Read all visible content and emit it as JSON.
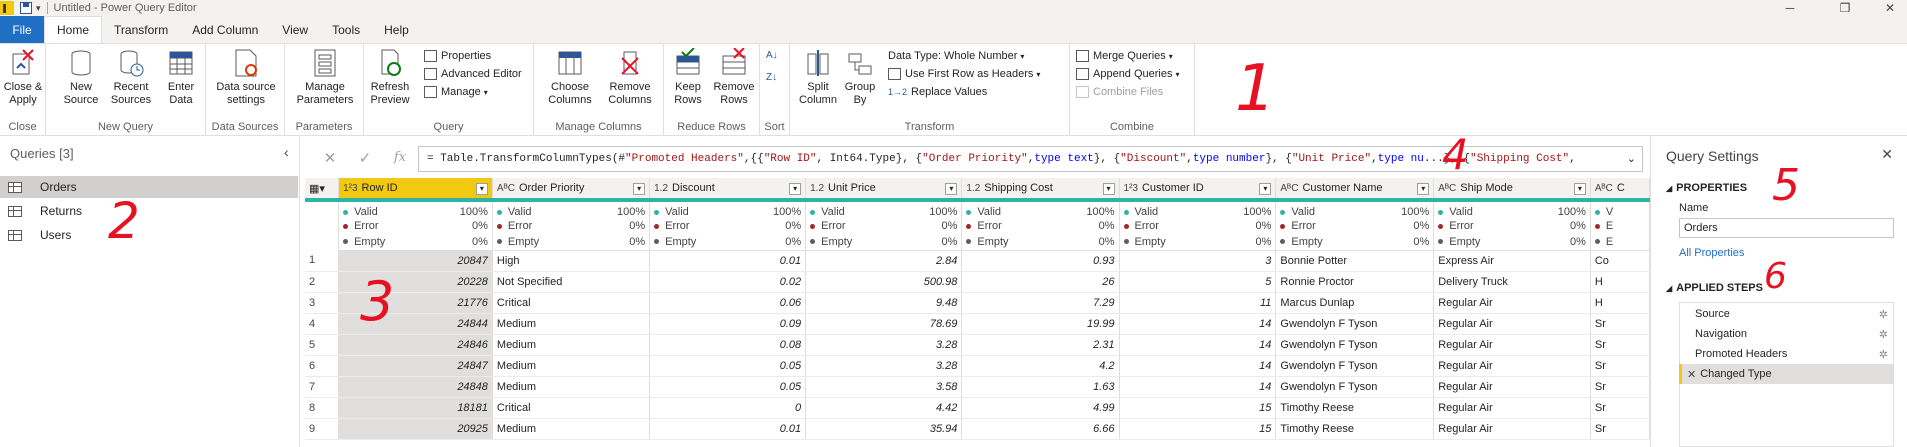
{
  "title": "Untitled - Power Query Editor",
  "tabs": [
    "File",
    "Home",
    "Transform",
    "Add Column",
    "View",
    "Tools",
    "Help"
  ],
  "ribbon": {
    "close_apply": "Close &\nApply",
    "close_group": "Close",
    "new_source": "New\nSource",
    "recent_sources": "Recent\nSources",
    "enter_data": "Enter\nData",
    "new_query_group": "New Query",
    "data_source_settings": "Data source\nsettings",
    "data_sources_group": "Data Sources",
    "manage_parameters": "Manage\nParameters",
    "parameters_group": "Parameters",
    "refresh_preview": "Refresh\nPreview",
    "properties": "Properties",
    "advanced_editor": "Advanced Editor",
    "manage": "Manage",
    "query_group": "Query",
    "choose_columns": "Choose\nColumns",
    "remove_columns": "Remove\nColumns",
    "manage_columns_group": "Manage Columns",
    "keep_rows": "Keep\nRows",
    "remove_rows": "Remove\nRows",
    "reduce_rows_group": "Reduce Rows",
    "sort_group": "Sort",
    "split_column": "Split\nColumn",
    "group_by": "Group\nBy",
    "data_type": "Data Type: Whole Number",
    "use_first_row": "Use First Row as Headers",
    "replace_values": "Replace Values",
    "transform_group": "Transform",
    "merge_queries": "Merge Queries",
    "append_queries": "Append Queries",
    "combine_files": "Combine Files",
    "combine_group": "Combine"
  },
  "formula": {
    "prefix": "= Table.TransformColumnTypes(#",
    "s1": "\"Promoted Headers\"",
    "p2": ",{{",
    "s2": "\"Row ID\"",
    "p3": ", Int64.Type}, {",
    "s3": "\"Order Priority\"",
    "p4": ", ",
    "k4": "type text",
    "p5": "}, {",
    "s5": "\"Discount\"",
    "p6": ", ",
    "k6": "type number",
    "p7": "}, {",
    "s7": "\"Unit Price\"",
    "p8": ", ",
    "k8": "type nu",
    "p9": "...}, {",
    "s9": "\"Shipping Cost\"",
    "p10": ","
  },
  "queries": {
    "header": "Queries [3]",
    "items": [
      "Orders",
      "Returns",
      "Users"
    ]
  },
  "columns": [
    {
      "type": "1²3",
      "name": "Row ID"
    },
    {
      "type": "AᴮC",
      "name": "Order Priority"
    },
    {
      "type": "1.2",
      "name": "Discount"
    },
    {
      "type": "1.2",
      "name": "Unit Price"
    },
    {
      "type": "1.2",
      "name": "Shipping Cost"
    },
    {
      "type": "1²3",
      "name": "Customer ID"
    },
    {
      "type": "AᴮC",
      "name": "Customer Name"
    },
    {
      "type": "AᴮC",
      "name": "Ship Mode"
    },
    {
      "type": "AᴮC",
      "name": "C"
    }
  ],
  "profile": {
    "valid": "Valid",
    "error": "Error",
    "empty": "Empty",
    "valid_pct": "100%",
    "error_pct": "0%",
    "empty_pct": "0%",
    "valid_short": "V",
    "error_short": "E",
    "empty_short": "E"
  },
  "rows": [
    [
      "1",
      "20847",
      "High",
      "0.01",
      "2.84",
      "0.93",
      "3",
      "Bonnie Potter",
      "Express Air",
      "Co"
    ],
    [
      "2",
      "20228",
      "Not Specified",
      "0.02",
      "500.98",
      "26",
      "5",
      "Ronnie Proctor",
      "Delivery Truck",
      "H"
    ],
    [
      "3",
      "21776",
      "Critical",
      "0.06",
      "9.48",
      "7.29",
      "11",
      "Marcus Dunlap",
      "Regular Air",
      "H"
    ],
    [
      "4",
      "24844",
      "Medium",
      "0.09",
      "78.69",
      "19.99",
      "14",
      "Gwendolyn F Tyson",
      "Regular Air",
      "Sr"
    ],
    [
      "5",
      "24846",
      "Medium",
      "0.08",
      "3.28",
      "2.31",
      "14",
      "Gwendolyn F Tyson",
      "Regular Air",
      "Sr"
    ],
    [
      "6",
      "24847",
      "Medium",
      "0.05",
      "3.28",
      "4.2",
      "14",
      "Gwendolyn F Tyson",
      "Regular Air",
      "Sr"
    ],
    [
      "7",
      "24848",
      "Medium",
      "0.05",
      "3.58",
      "1.63",
      "14",
      "Gwendolyn F Tyson",
      "Regular Air",
      "Sr"
    ],
    [
      "8",
      "18181",
      "Critical",
      "0",
      "4.42",
      "4.99",
      "15",
      "Timothy Reese",
      "Regular Air",
      "Sr"
    ],
    [
      "9",
      "20925",
      "Medium",
      "0.01",
      "35.94",
      "6.66",
      "15",
      "Timothy Reese",
      "Regular Air",
      "Sr"
    ]
  ],
  "settings": {
    "title": "Query Settings",
    "properties": "PROPERTIES",
    "name_label": "Name",
    "name_value": "Orders",
    "all_properties": "All Properties",
    "applied_steps": "APPLIED STEPS",
    "steps": [
      "Source",
      "Navigation",
      "Promoted Headers",
      "Changed Type"
    ]
  },
  "annotations": [
    "1",
    "2",
    "3",
    "4",
    "5",
    "6"
  ]
}
